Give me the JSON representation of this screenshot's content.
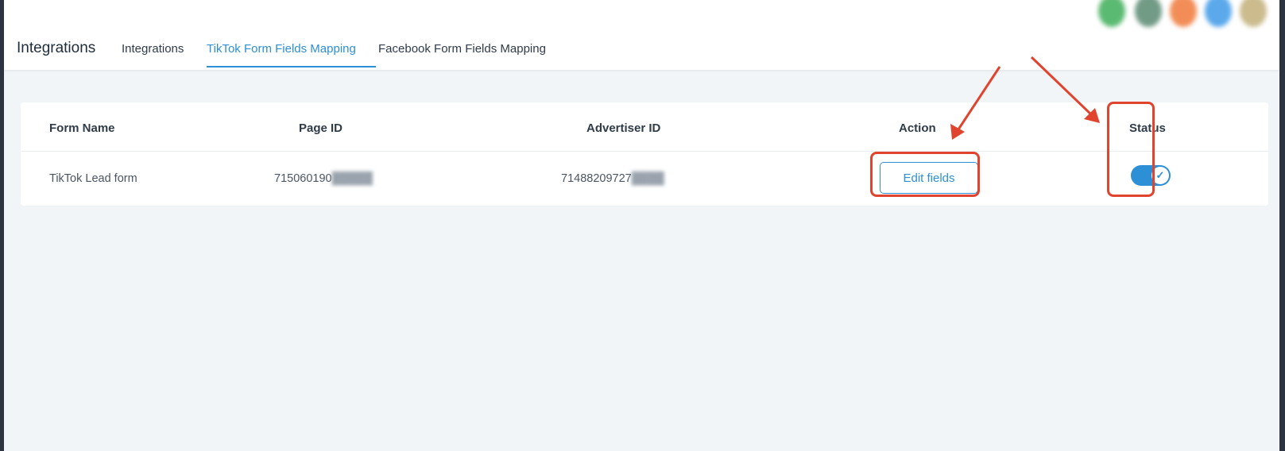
{
  "header": {
    "page_title": "Integrations",
    "tabs": [
      {
        "label": "Integrations",
        "active": false
      },
      {
        "label": "TikTok Form Fields Mapping",
        "active": true
      },
      {
        "label": "Facebook Form Fields Mapping",
        "active": false
      }
    ],
    "avatar_colors": [
      "#3fae5a",
      "#5a8a72",
      "#f07a3a",
      "#3f9ae8",
      "#c2b07a"
    ]
  },
  "table": {
    "columns": [
      "Form Name",
      "Page ID",
      "Advertiser ID",
      "Action",
      "Status"
    ],
    "rows": [
      {
        "form_name": "TikTok Lead form",
        "page_id_visible": "715060190",
        "advertiser_id_visible": "71488209727",
        "action_label": "Edit fields",
        "status_on": true,
        "status_icon": "check-icon"
      }
    ]
  },
  "colors": {
    "accent": "#2d8fd5",
    "annotation": "#e0442f",
    "page_bg": "#f1f5f8"
  }
}
